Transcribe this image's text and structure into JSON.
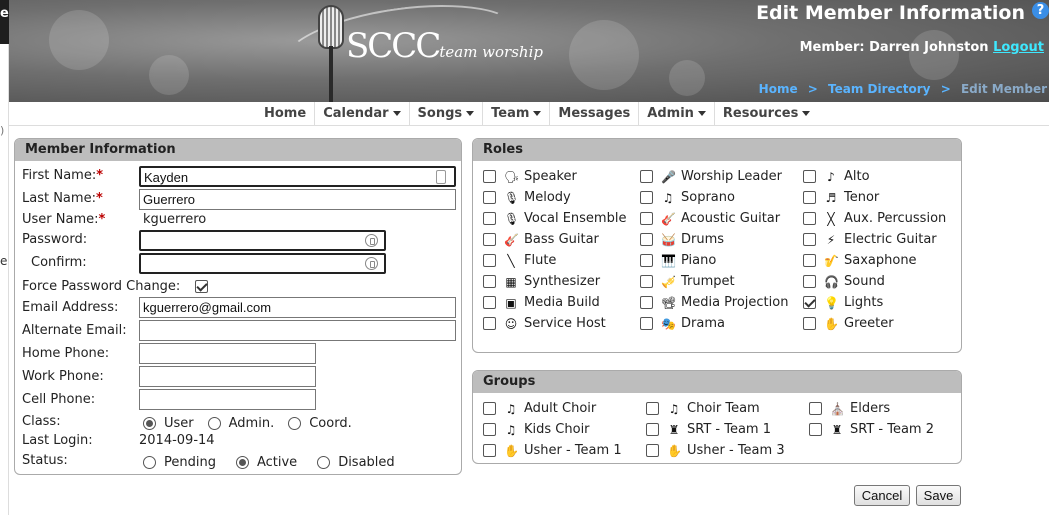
{
  "header": {
    "logo_main": "SCCC",
    "logo_sub": "team worship",
    "title": "Edit Member Information",
    "help_glyph": "?",
    "member_label": "Member: Darren Johnston",
    "logout": "Logout",
    "breadcrumb": {
      "home": "Home",
      "sep": ">",
      "directory": "Team Directory",
      "current": "Edit Member"
    }
  },
  "nav": {
    "home": "Home",
    "calendar": "Calendar",
    "songs": "Songs",
    "team": "Team",
    "messages": "Messages",
    "admin": "Admin",
    "resources": "Resources"
  },
  "member_info": {
    "heading": "Member Information",
    "first_name_label": "First Name:",
    "first_name": "Kayden",
    "last_name_label": "Last Name:",
    "last_name": "Guerrero",
    "user_name_label": "User Name:",
    "user_name": "kguerrero",
    "required_mark": "*",
    "password_label": "Password:",
    "confirm_label": "Confirm:",
    "force_change_label": "Force Password Change:",
    "force_change_checked": true,
    "email_label": "Email Address:",
    "email": "kguerrero@gmail.com",
    "alt_email_label": "Alternate Email:",
    "home_phone_label": "Home Phone:",
    "work_phone_label": "Work Phone:",
    "cell_phone_label": "Cell Phone:",
    "class_label": "Class:",
    "class_options": [
      "User",
      "Admin.",
      "Coord."
    ],
    "class_selected": "User",
    "last_login_label": "Last Login:",
    "last_login": "2014-09-14",
    "status_label": "Status:",
    "status_options": [
      "Pending",
      "Active",
      "Disabled"
    ],
    "status_selected": "Active"
  },
  "roles": {
    "heading": "Roles",
    "items": [
      {
        "label": "Speaker",
        "icon": "speaker-icon",
        "checked": false
      },
      {
        "label": "Worship Leader",
        "icon": "worship-leader-icon",
        "checked": false
      },
      {
        "label": "Alto",
        "icon": "alto-icon",
        "checked": false
      },
      {
        "label": "Melody",
        "icon": "melody-icon",
        "checked": false
      },
      {
        "label": "Soprano",
        "icon": "soprano-icon",
        "checked": false
      },
      {
        "label": "Tenor",
        "icon": "tenor-icon",
        "checked": false
      },
      {
        "label": "Vocal Ensemble",
        "icon": "vocal-ensemble-icon",
        "checked": false
      },
      {
        "label": "Acoustic Guitar",
        "icon": "acoustic-guitar-icon",
        "checked": false
      },
      {
        "label": "Aux. Percussion",
        "icon": "aux-percussion-icon",
        "checked": false
      },
      {
        "label": "Bass Guitar",
        "icon": "bass-guitar-icon",
        "checked": false
      },
      {
        "label": "Drums",
        "icon": "drums-icon",
        "checked": false
      },
      {
        "label": "Electric Guitar",
        "icon": "electric-guitar-icon",
        "checked": false
      },
      {
        "label": "Flute",
        "icon": "flute-icon",
        "checked": false
      },
      {
        "label": "Piano",
        "icon": "piano-icon",
        "checked": false
      },
      {
        "label": "Saxaphone",
        "icon": "saxaphone-icon",
        "checked": false
      },
      {
        "label": "Synthesizer",
        "icon": "synthesizer-icon",
        "checked": false
      },
      {
        "label": "Trumpet",
        "icon": "trumpet-icon",
        "checked": false
      },
      {
        "label": "Sound",
        "icon": "sound-icon",
        "checked": false
      },
      {
        "label": "Media Build",
        "icon": "media-build-icon",
        "checked": false
      },
      {
        "label": "Media Projection",
        "icon": "media-projection-icon",
        "checked": false
      },
      {
        "label": "Lights",
        "icon": "lights-icon",
        "checked": true
      },
      {
        "label": "Service Host",
        "icon": "service-host-icon",
        "checked": false
      },
      {
        "label": "Drama",
        "icon": "drama-icon",
        "checked": false
      },
      {
        "label": "Greeter",
        "icon": "greeter-icon",
        "checked": false
      }
    ]
  },
  "groups": {
    "heading": "Groups",
    "items": [
      {
        "label": "Adult Choir",
        "icon": "choir-icon",
        "checked": false
      },
      {
        "label": "Choir Team",
        "icon": "choir-icon",
        "checked": false
      },
      {
        "label": "Elders",
        "icon": "elders-icon",
        "checked": false
      },
      {
        "label": "Kids Choir",
        "icon": "choir-icon",
        "checked": false
      },
      {
        "label": "SRT - Team 1",
        "icon": "srt-icon",
        "checked": false
      },
      {
        "label": "SRT - Team 2",
        "icon": "srt-icon",
        "checked": false
      },
      {
        "label": "Usher - Team 1",
        "icon": "usher-icon",
        "checked": false
      },
      {
        "label": "Usher - Team 3",
        "icon": "usher-icon",
        "checked": false
      }
    ]
  },
  "buttons": {
    "cancel": "Cancel",
    "save": "Save"
  },
  "colors": {
    "link": "#5ab4ff",
    "logout": "#3ee8ff",
    "panel_header": "#bdbdbd",
    "required": "#b00000"
  }
}
